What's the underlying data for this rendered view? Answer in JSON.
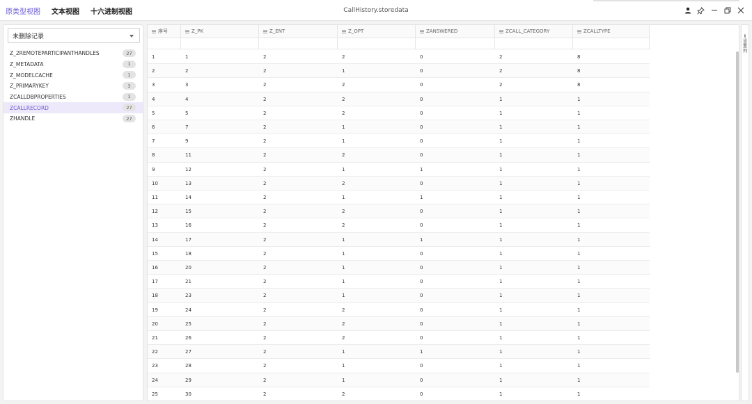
{
  "header": {
    "tabs": [
      {
        "label": "原类型视图",
        "active": true
      },
      {
        "label": "文本视图",
        "active": false
      },
      {
        "label": "十六进制视图",
        "active": false
      }
    ],
    "title": "CallHistory.storedata",
    "controls": [
      "user-icon",
      "pin-icon",
      "minimize-icon",
      "restore-icon",
      "close-icon"
    ]
  },
  "sidebar": {
    "filter_value": "未删除记录",
    "tables": [
      {
        "name": "Z_2REMOTEPARTICIPANTHANDLES",
        "count": "27"
      },
      {
        "name": "Z_METADATA",
        "count": "1"
      },
      {
        "name": "Z_MODELCACHE",
        "count": "1"
      },
      {
        "name": "Z_PRIMARYKEY",
        "count": "3"
      },
      {
        "name": "ZCALLDBPROPERTIES",
        "count": "1"
      },
      {
        "name": "ZCALLRECORD",
        "count": "27",
        "active": true
      },
      {
        "name": "ZHANDLE",
        "count": "27"
      }
    ]
  },
  "grid": {
    "columns": [
      "序号",
      "Z_PK",
      "Z_ENT",
      "Z_OPT",
      "ZANSWERED",
      "ZCALL_CATEGORY",
      "ZCALLTYPE"
    ],
    "rows": [
      [
        "1",
        "1",
        "2",
        "2",
        "0",
        "2",
        "8"
      ],
      [
        "2",
        "2",
        "2",
        "1",
        "0",
        "2",
        "8"
      ],
      [
        "3",
        "3",
        "2",
        "2",
        "0",
        "2",
        "8"
      ],
      [
        "4",
        "4",
        "2",
        "2",
        "0",
        "1",
        "1"
      ],
      [
        "5",
        "5",
        "2",
        "2",
        "0",
        "1",
        "1"
      ],
      [
        "6",
        "7",
        "2",
        "1",
        "0",
        "1",
        "1"
      ],
      [
        "7",
        "9",
        "2",
        "1",
        "0",
        "1",
        "1"
      ],
      [
        "8",
        "11",
        "2",
        "2",
        "0",
        "1",
        "1"
      ],
      [
        "9",
        "12",
        "2",
        "1",
        "1",
        "1",
        "1"
      ],
      [
        "10",
        "13",
        "2",
        "2",
        "0",
        "1",
        "1"
      ],
      [
        "11",
        "14",
        "2",
        "1",
        "1",
        "1",
        "1"
      ],
      [
        "12",
        "15",
        "2",
        "2",
        "0",
        "1",
        "1"
      ],
      [
        "13",
        "16",
        "2",
        "2",
        "0",
        "1",
        "1"
      ],
      [
        "14",
        "17",
        "2",
        "1",
        "1",
        "1",
        "1"
      ],
      [
        "15",
        "18",
        "2",
        "1",
        "0",
        "1",
        "1"
      ],
      [
        "16",
        "20",
        "2",
        "1",
        "0",
        "1",
        "1"
      ],
      [
        "17",
        "21",
        "2",
        "1",
        "0",
        "1",
        "1"
      ],
      [
        "18",
        "23",
        "2",
        "1",
        "0",
        "1",
        "1"
      ],
      [
        "19",
        "24",
        "2",
        "2",
        "0",
        "1",
        "1"
      ],
      [
        "20",
        "25",
        "2",
        "2",
        "0",
        "1",
        "1"
      ],
      [
        "21",
        "26",
        "2",
        "2",
        "0",
        "1",
        "1"
      ],
      [
        "22",
        "27",
        "2",
        "1",
        "1",
        "1",
        "1"
      ],
      [
        "23",
        "28",
        "2",
        "1",
        "0",
        "1",
        "1"
      ],
      [
        "24",
        "29",
        "2",
        "1",
        "0",
        "1",
        "1"
      ],
      [
        "25",
        "30",
        "2",
        "2",
        "0",
        "1",
        "1"
      ]
    ]
  },
  "side_panel": {
    "label": "设置列"
  },
  "colors": {
    "accent": "#6b5bd6",
    "active_row_bg": "#ede9fa"
  }
}
